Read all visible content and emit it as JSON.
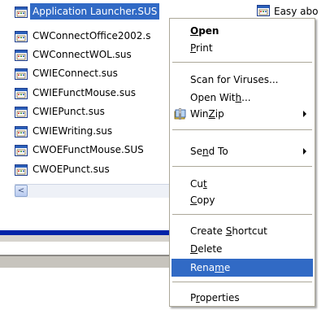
{
  "files": [
    {
      "name": "Application Launcher.SUS",
      "selected": true
    },
    {
      "name": "CWConnectOffice2002.s",
      "selected": false
    },
    {
      "name": "CWConnectWOL.sus",
      "selected": false
    },
    {
      "name": "CWIEConnect.sus",
      "selected": false
    },
    {
      "name": "CWIEFunctMouse.sus",
      "selected": false
    },
    {
      "name": "CWIEPunct.sus",
      "selected": false
    },
    {
      "name": "CWIEWriting.sus",
      "selected": false
    },
    {
      "name": "CWOEFunctMouse.SUS",
      "selected": false
    },
    {
      "name": "CWOEPunct.sus",
      "selected": false
    }
  ],
  "right_file": {
    "name": "Easy abo"
  },
  "scrollbar": {
    "left_arrow_icon": "chevron-left-icon",
    "arrow_glyph": "<"
  },
  "colors": {
    "selection": "#316ac5",
    "menu_border": "#aca899",
    "band_blue": "#0023a8"
  },
  "context_menu": {
    "items": [
      {
        "pre": "",
        "ul": "O",
        "post": "pen",
        "bold": true
      },
      {
        "pre": "",
        "ul": "P",
        "post": "rint",
        "bold": false
      },
      {
        "pre": "Scan for Viruses...",
        "ul": "",
        "post": "",
        "bold": false
      },
      {
        "pre": "Open Wit",
        "ul": "h",
        "post": "...",
        "bold": false
      },
      {
        "pre": "Win",
        "ul": "Z",
        "post": "ip",
        "bold": false,
        "submenu": true,
        "icon": "winzip-icon"
      },
      {
        "pre": "Se",
        "ul": "n",
        "post": "d To",
        "bold": false,
        "submenu": true
      },
      {
        "pre": "Cu",
        "ul": "t",
        "post": "",
        "bold": false
      },
      {
        "pre": "",
        "ul": "C",
        "post": "opy",
        "bold": false
      },
      {
        "pre": "Create ",
        "ul": "S",
        "post": "hortcut",
        "bold": false
      },
      {
        "pre": "",
        "ul": "D",
        "post": "elete",
        "bold": false
      },
      {
        "pre": "Rena",
        "ul": "m",
        "post": "e",
        "bold": false,
        "highlight": true
      },
      {
        "pre": "P",
        "ul": "r",
        "post": "operties",
        "bold": false
      }
    ]
  }
}
